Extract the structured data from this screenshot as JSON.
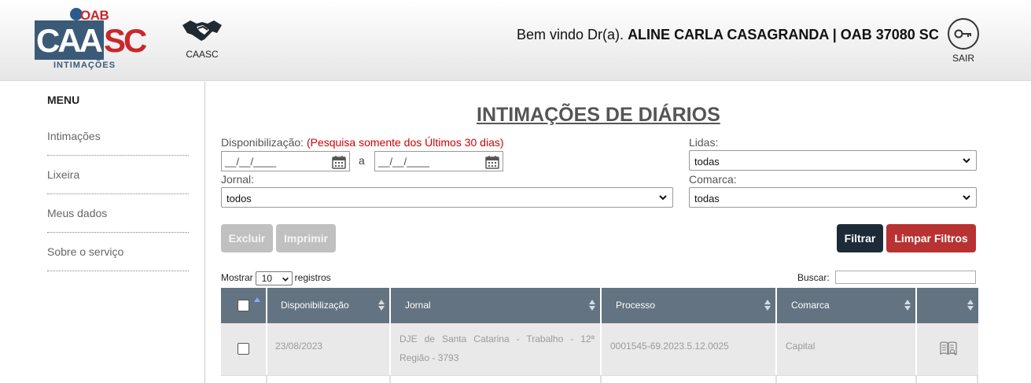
{
  "header": {
    "logo": {
      "oab": "OAB",
      "caa": "CAA",
      "sc": "SC",
      "subtitle": "INTIMAÇÕES"
    },
    "caasc_label": "CAASC",
    "welcome_prefix": "Bem vindo Dr(a).",
    "welcome_user": "ALINE CARLA CASAGRANDA | OAB 37080 SC",
    "logout_label": "SAIR",
    "icons": {
      "caasc": "handshake-icon",
      "logout": "key-icon"
    }
  },
  "sidebar": {
    "title": "MENU",
    "items": [
      {
        "label": "Intimações"
      },
      {
        "label": "Lixeira"
      },
      {
        "label": "Meus dados"
      },
      {
        "label": "Sobre o serviço"
      }
    ]
  },
  "main": {
    "title": "INTIMAÇÕES DE DIÁRIOS",
    "filters": {
      "disponibilizacao_label": "Disponibilização:",
      "disponibilizacao_note": "(Pesquisa somente dos Últimos 30 dias)",
      "date_from": "__/__/____",
      "date_to": "__/__/____",
      "date_separator": "a",
      "jornal_label": "Jornal:",
      "jornal_value": "todos",
      "lidas_label": "Lidas:",
      "lidas_value": "todas",
      "comarca_label": "Comarca:",
      "comarca_value": "todas"
    },
    "buttons": {
      "excluir": "Excluir",
      "imprimir": "Imprimir",
      "filtrar": "Filtrar",
      "limpar": "Limpar Filtros"
    },
    "table_controls": {
      "show_prefix": "Mostrar",
      "page_size": "10",
      "show_suffix": "registros",
      "search_label": "Buscar:"
    },
    "table": {
      "columns": [
        "",
        "Disponibilização",
        "Jornal",
        "Processo",
        "Comarca",
        ""
      ],
      "rows": [
        {
          "disponibilizacao": "23/08/2023",
          "jornal_line1": "DJE de Santa Catarina - Trabalho - 12ª",
          "jornal_line2": "Região - 3793",
          "processo": "0001545-69.2023.5.12.0025",
          "comarca": "Capital"
        }
      ]
    }
  },
  "colors": {
    "brand_blue": "#3b5a78",
    "brand_red": "#c8282d",
    "table_header": "#637381",
    "filter_button": "#1d2b38",
    "clear_button": "#b83232",
    "note_red": "#d40000"
  }
}
